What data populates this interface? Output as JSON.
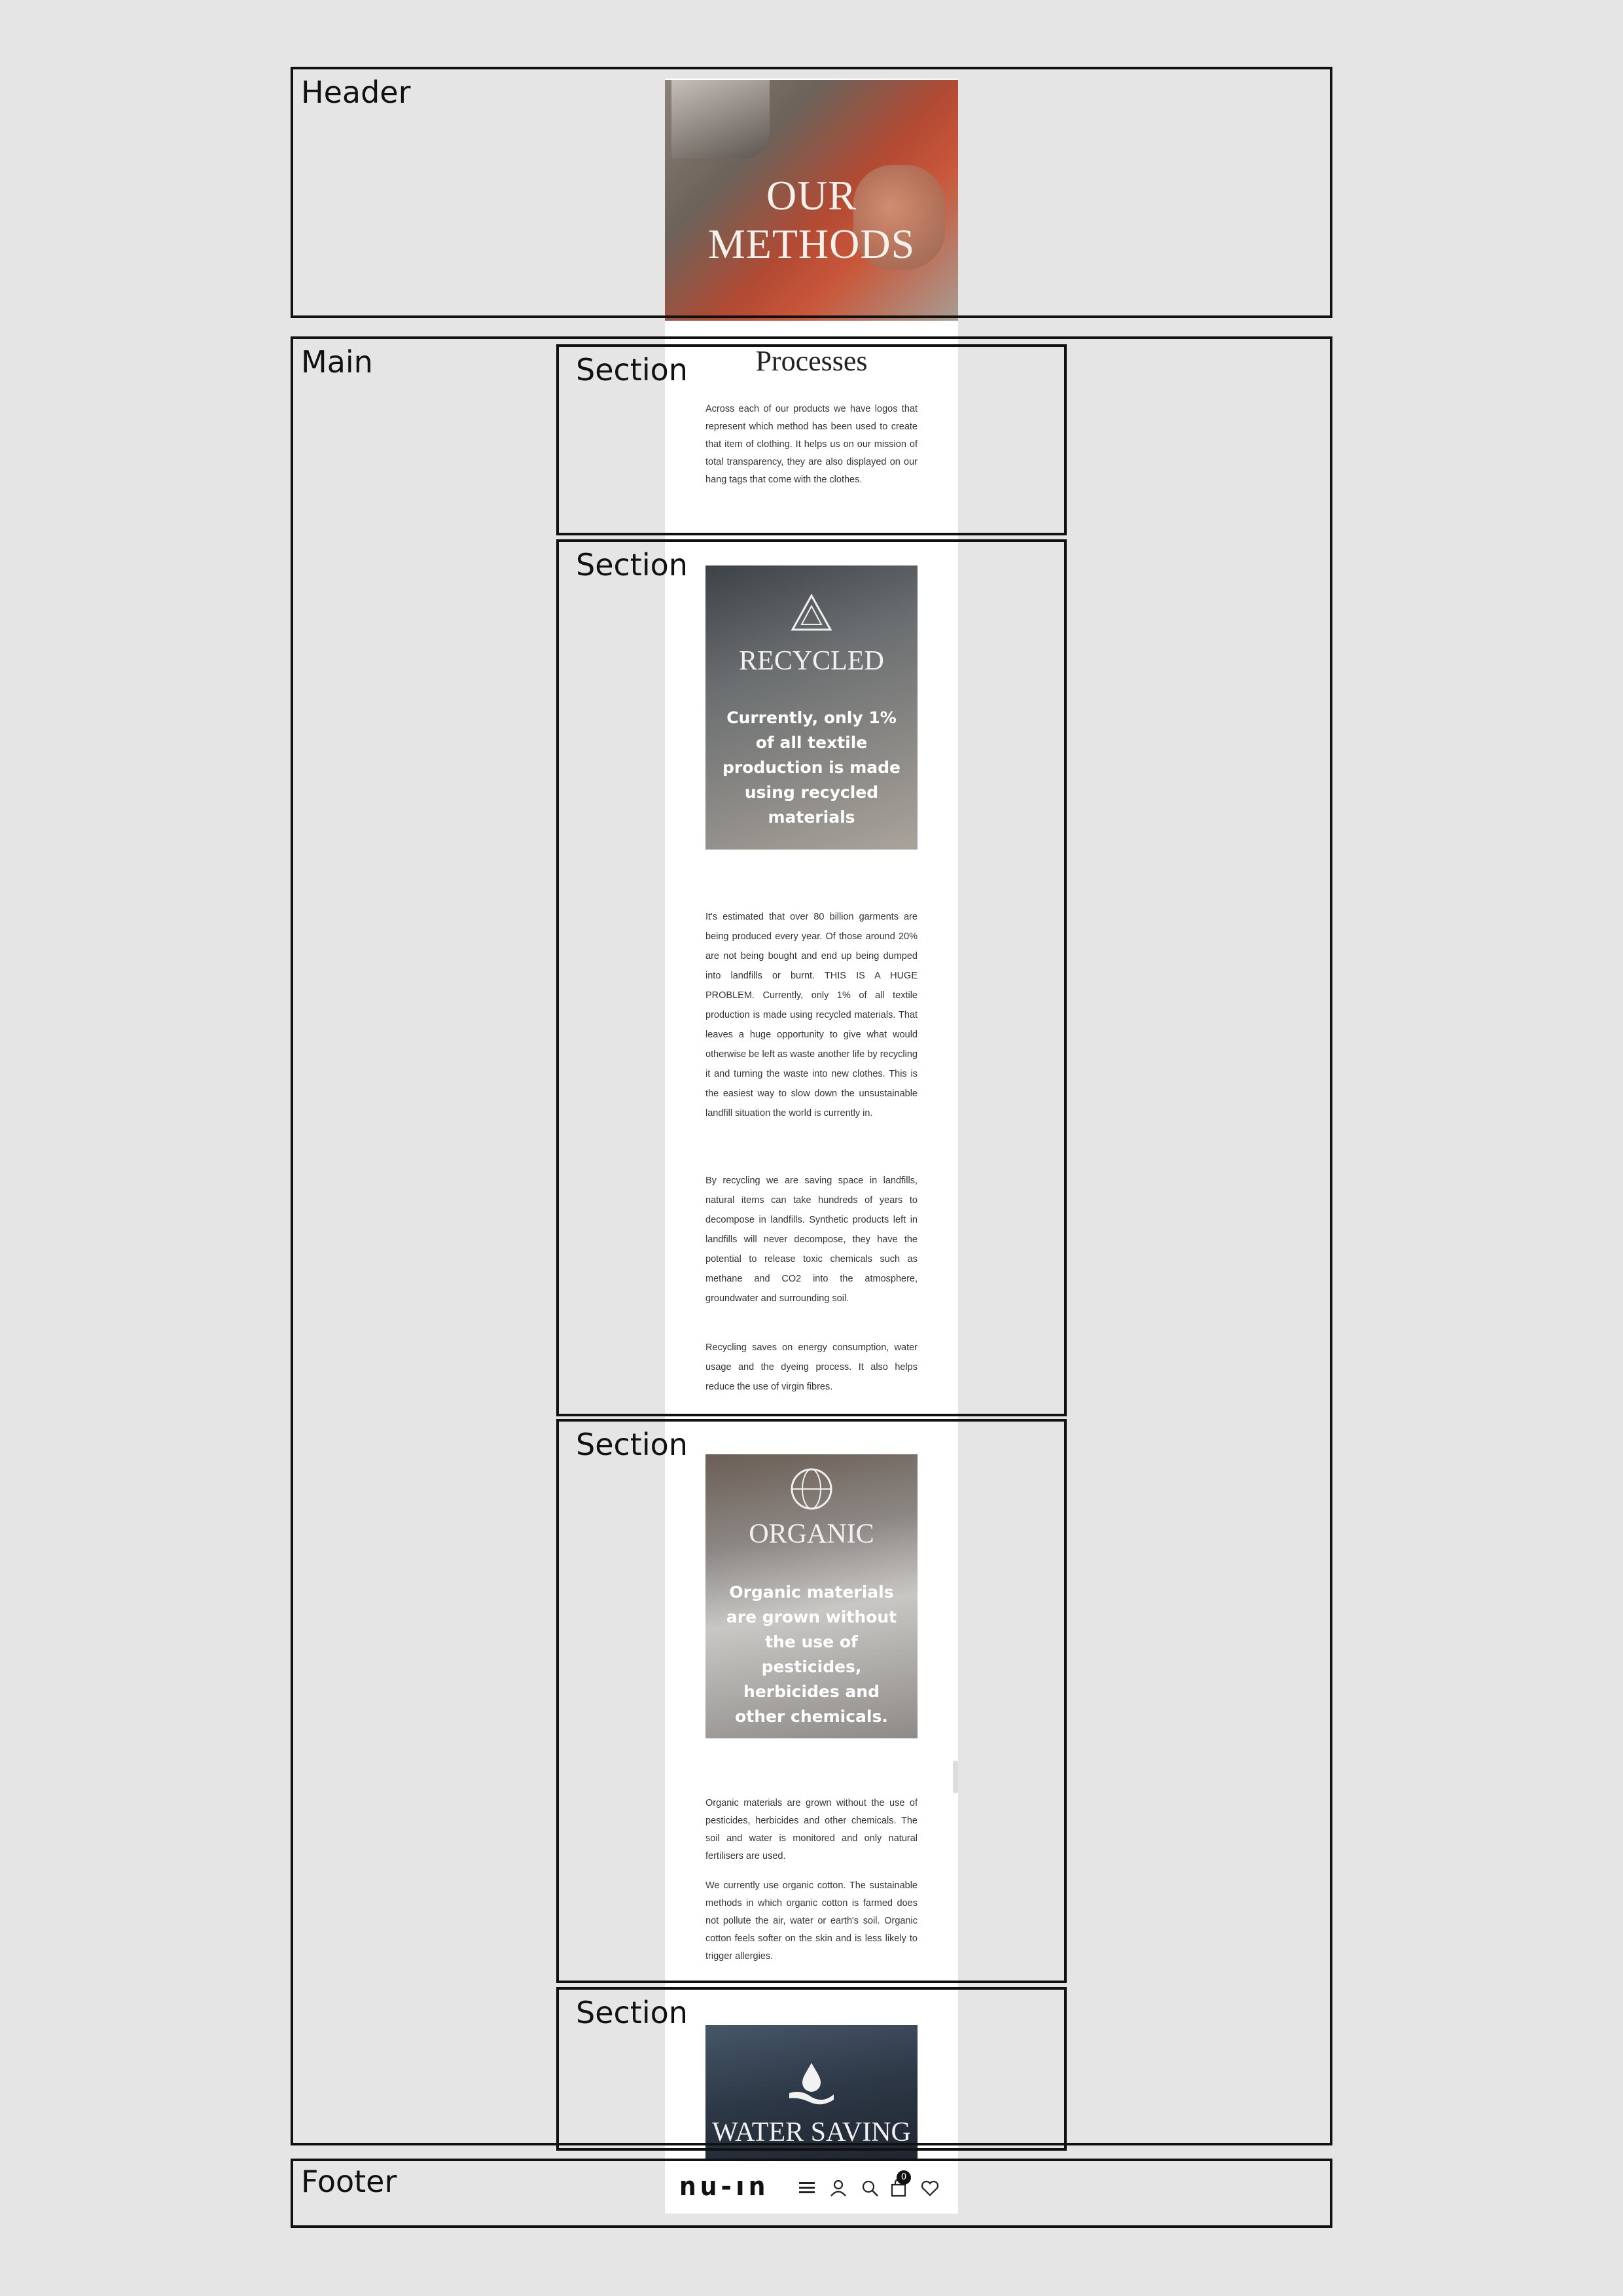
{
  "layout_labels": {
    "header": "Header",
    "main": "Main",
    "section": "Section",
    "footer": "Footer"
  },
  "hero": {
    "title": "OUR METHODS"
  },
  "processes": {
    "title": "Processes",
    "text": "Across each of our products we have logos that represent which method has been used to create that item of clothing. It helps us on our mission of total transparency, they are also displayed on our hang tags that come with the clothes."
  },
  "recycled": {
    "icon": "recycle-icon",
    "title": "RECYCLED",
    "overlay": "Currently, only 1% of all textile production is made using recycled materials",
    "paragraphs": [
      "It's estimated that over 80 billion garments are being produced every year. Of those around 20% are not being bought and end up being dumped into landfills or burnt. THIS IS A HUGE PROBLEM. Currently, only 1% of all textile production is made using recycled materials. That leaves a huge opportunity to give what would otherwise be left as waste another life by recycling it and turning the waste into new clothes. This is the easiest way to slow down the unsustainable landfill situation the world is currently in.",
      "By recycling we are saving space in landfills, natural items can take hundreds of years to decompose in landfills. Synthetic products left in landfills will never decompose, they have the potential to release toxic chemicals such as methane and CO2 into the atmosphere, groundwater and surrounding soil.",
      "Recycling saves on energy consumption, water usage and the dyeing process. It also helps reduce the use of virgin fibres."
    ]
  },
  "organic": {
    "icon": "globe-leaf-icon",
    "title": "ORGANIC",
    "overlay": "Organic materials are grown without the use of pesticides, herbicides and other chemicals.",
    "paragraphs": [
      "Organic materials are grown without the use of pesticides, herbicides and other chemicals. The soil and water is monitored and only natural fertilisers are used.",
      "We currently use organic cotton. The sustainable methods in which organic cotton is farmed does not pollute the air, water or earth's soil. Organic cotton feels softer on the skin and is less likely to trigger allergies."
    ]
  },
  "water_saving": {
    "icon": "water-drop-hand-icon",
    "title": "WATER SAVING"
  },
  "footer": {
    "logo": "ոս-ıո",
    "cart_count": "0",
    "icons": [
      "menu-icon",
      "user-icon",
      "search-icon",
      "bag-icon",
      "heart-icon"
    ]
  }
}
